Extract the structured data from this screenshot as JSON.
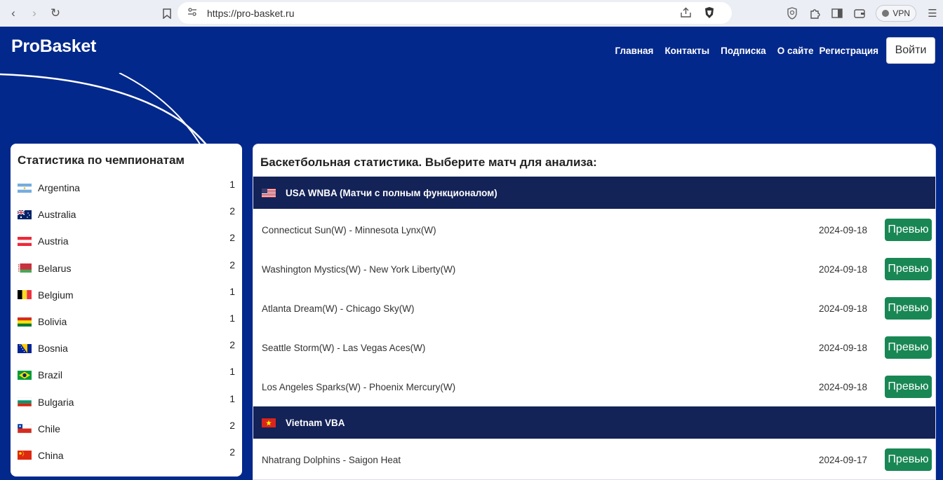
{
  "browser": {
    "url": "https://pro-basket.ru",
    "vpn_label": "VPN"
  },
  "header": {
    "brand": "ProBasket",
    "nav": [
      "Главная",
      "Контакты",
      "Подписка",
      "О сайте",
      "Регистрация"
    ],
    "login_label": "Войти"
  },
  "sidebar": {
    "title": "Статистика по чемпионатам",
    "countries": [
      {
        "name": "Argentina",
        "count": "1",
        "flag": "argentina"
      },
      {
        "name": "Australia",
        "count": "2",
        "flag": "australia"
      },
      {
        "name": "Austria",
        "count": "2",
        "flag": "austria"
      },
      {
        "name": "Belarus",
        "count": "2",
        "flag": "belarus"
      },
      {
        "name": "Belgium",
        "count": "1",
        "flag": "belgium"
      },
      {
        "name": "Bolivia",
        "count": "1",
        "flag": "bolivia"
      },
      {
        "name": "Bosnia",
        "count": "2",
        "flag": "bosnia"
      },
      {
        "name": "Brazil",
        "count": "1",
        "flag": "brazil"
      },
      {
        "name": "Bulgaria",
        "count": "1",
        "flag": "bulgaria"
      },
      {
        "name": "Chile",
        "count": "2",
        "flag": "chile"
      },
      {
        "name": "China",
        "count": "2",
        "flag": "china"
      }
    ]
  },
  "main": {
    "title": "Баскетбольная статистика. Выберите матч для анализа:",
    "preview_label": "Превью",
    "leagues": [
      {
        "name": "USA WNBA (Матчи с полным функционалом)",
        "flag": "usa",
        "matches": [
          {
            "teams": "Connecticut Sun(W) - Minnesota Lynx(W)",
            "date": "2024-09-18"
          },
          {
            "teams": "Washington Mystics(W) - New York Liberty(W)",
            "date": "2024-09-18"
          },
          {
            "teams": "Atlanta Dream(W) - Chicago Sky(W)",
            "date": "2024-09-18"
          },
          {
            "teams": "Seattle Storm(W) - Las Vegas Aces(W)",
            "date": "2024-09-18"
          },
          {
            "teams": "Los Angeles Sparks(W) - Phoenix Mercury(W)",
            "date": "2024-09-18"
          }
        ]
      },
      {
        "name": "Vietnam VBA",
        "flag": "vietnam",
        "matches": [
          {
            "teams": "Nhatrang Dolphins - Saigon Heat",
            "date": "2024-09-17"
          }
        ]
      }
    ]
  },
  "colors": {
    "brand_blue": "#03288b",
    "league_header": "#132257",
    "preview_green": "#198754"
  }
}
